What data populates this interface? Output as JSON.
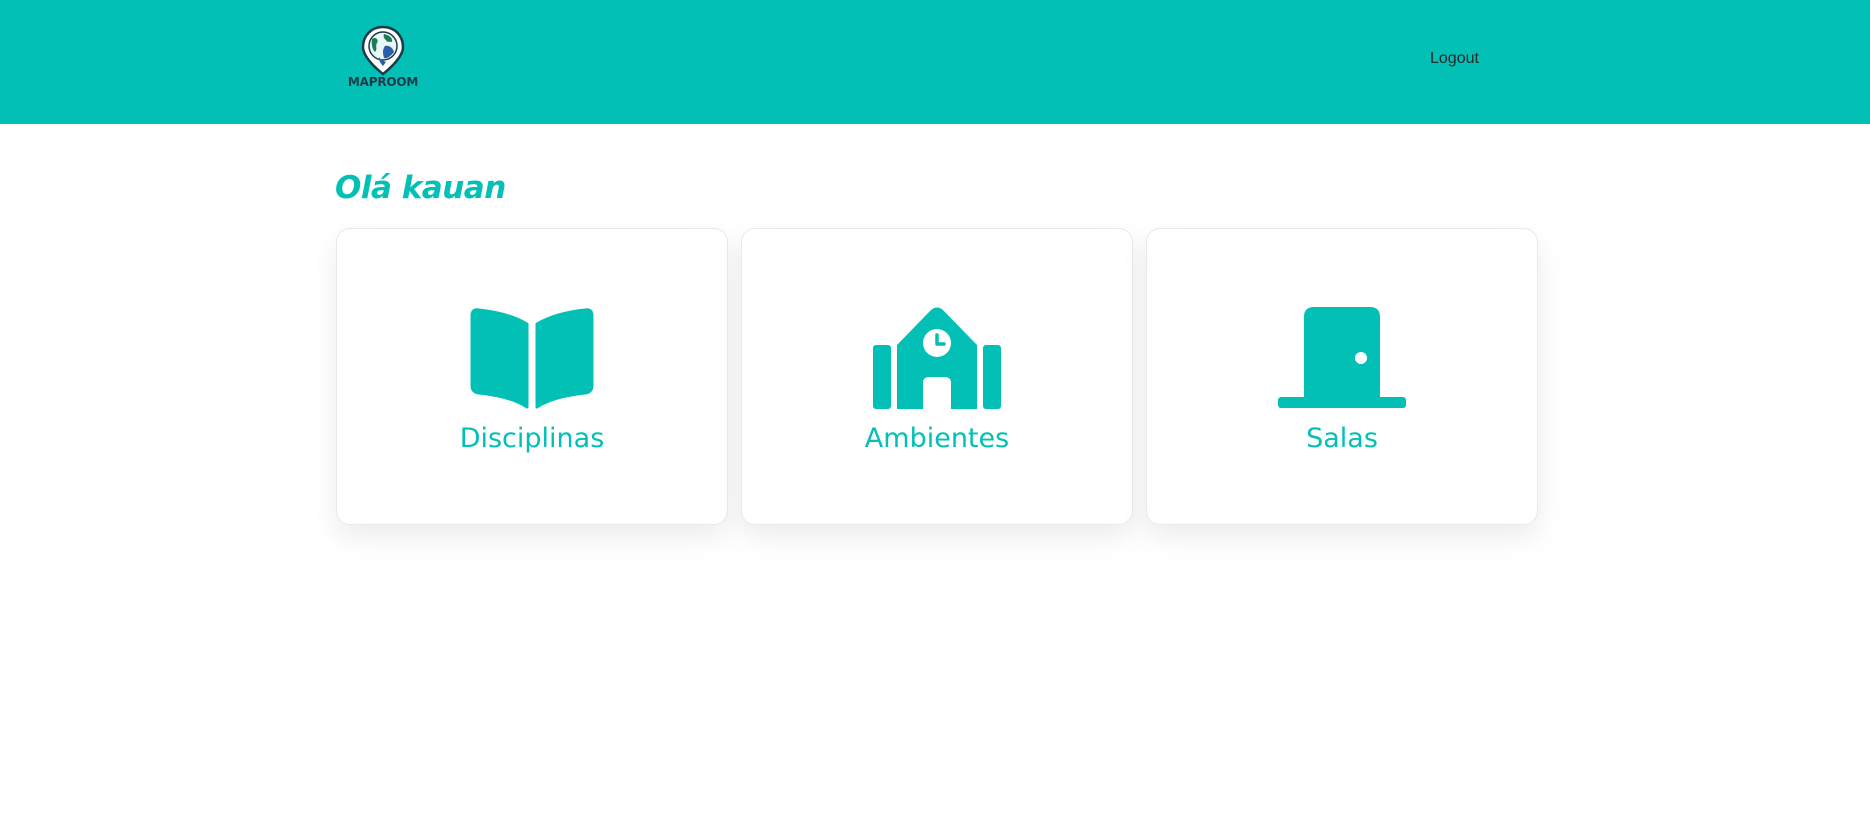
{
  "header": {
    "logo_text": "MAPROOM",
    "logout_label": "Logout"
  },
  "greeting": "Olá kauan",
  "cards": [
    {
      "label": "Disciplinas",
      "icon": "book-open-icon"
    },
    {
      "label": "Ambientes",
      "icon": "school-building-icon"
    },
    {
      "label": "Salas",
      "icon": "door-closed-icon"
    }
  ],
  "colors": {
    "primary": "#02c0b5",
    "header_text": "#1e2a2a",
    "background": "#ffffff"
  }
}
